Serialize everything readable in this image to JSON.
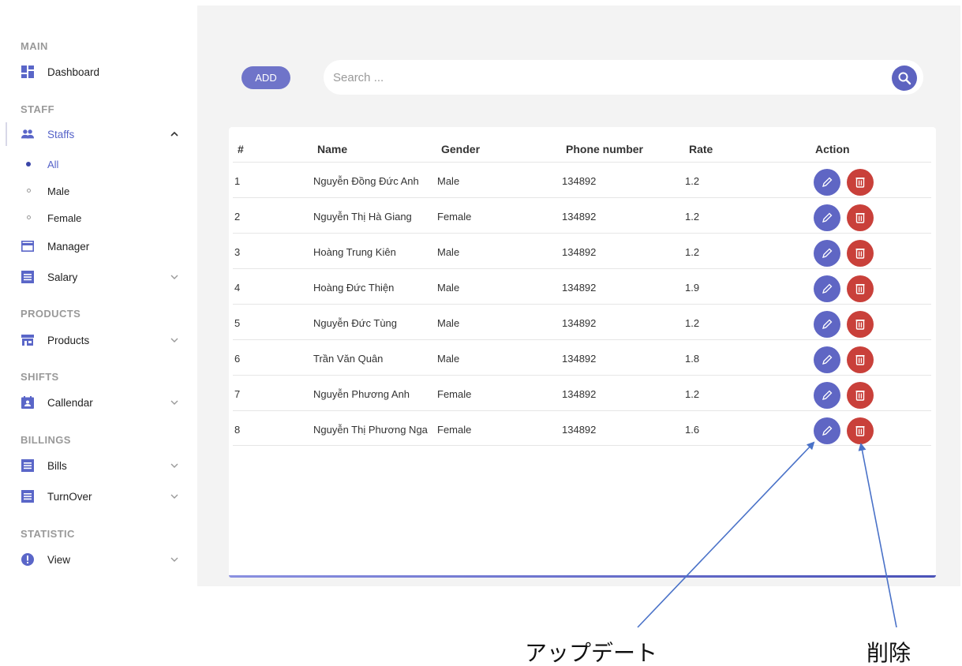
{
  "window": {
    "dot_colors": [
      "#ee3b36",
      "#f2c52b",
      "#2bbb3b"
    ]
  },
  "sidebar": {
    "sections": {
      "main": "MAIN",
      "staff": "STAFF",
      "products": "PRODUCTS",
      "shifts": "SHIFTS",
      "billings": "BILLINGS",
      "statistic": "STATISTIC"
    },
    "items": {
      "dashboard": "Dashboard",
      "staffs": "Staffs",
      "all": "All",
      "male": "Male",
      "female": "Female",
      "manager": "Manager",
      "salary": "Salary",
      "products": "Products",
      "calendar": "Callendar",
      "bills": "Bills",
      "turnover": "TurnOver",
      "view": "View"
    },
    "accent_color": "#5562c8"
  },
  "toolbar": {
    "add_label": "ADD",
    "search_placeholder": "Search ..."
  },
  "table": {
    "headers": {
      "index": "#",
      "name": "Name",
      "gender": "Gender",
      "phone": "Phone number",
      "rate": "Rate",
      "action": "Action"
    },
    "rows": [
      {
        "index": "1",
        "name": "Nguyễn Đồng Đức Anh",
        "gender": "Male",
        "phone": "134892",
        "rate": "1.2"
      },
      {
        "index": "2",
        "name": "Nguyễn Thị Hà Giang",
        "gender": "Female",
        "phone": "134892",
        "rate": "1.2"
      },
      {
        "index": "3",
        "name": "Hoàng Trung Kiên",
        "gender": "Male",
        "phone": "134892",
        "rate": "1.2"
      },
      {
        "index": "4",
        "name": "Hoàng Đức Thiện",
        "gender": "Male",
        "phone": "134892",
        "rate": "1.9"
      },
      {
        "index": "5",
        "name": "Nguyễn Đức Tùng",
        "gender": "Male",
        "phone": "134892",
        "rate": "1.2"
      },
      {
        "index": "6",
        "name": "Trần Văn Quân",
        "gender": "Male",
        "phone": "134892",
        "rate": "1.8"
      },
      {
        "index": "7",
        "name": "Nguyễn Phương Anh",
        "gender": "Female",
        "phone": "134892",
        "rate": "1.2"
      },
      {
        "index": "8",
        "name": "Nguyễn Thị Phương Nga",
        "gender": "Female",
        "phone": "134892",
        "rate": "1.6"
      }
    ],
    "edit_color": "#5f66c4",
    "delete_color": "#c9403a"
  },
  "annotations": {
    "update": "アップデート",
    "delete": "削除",
    "arrow_color": "#4a72c8"
  }
}
